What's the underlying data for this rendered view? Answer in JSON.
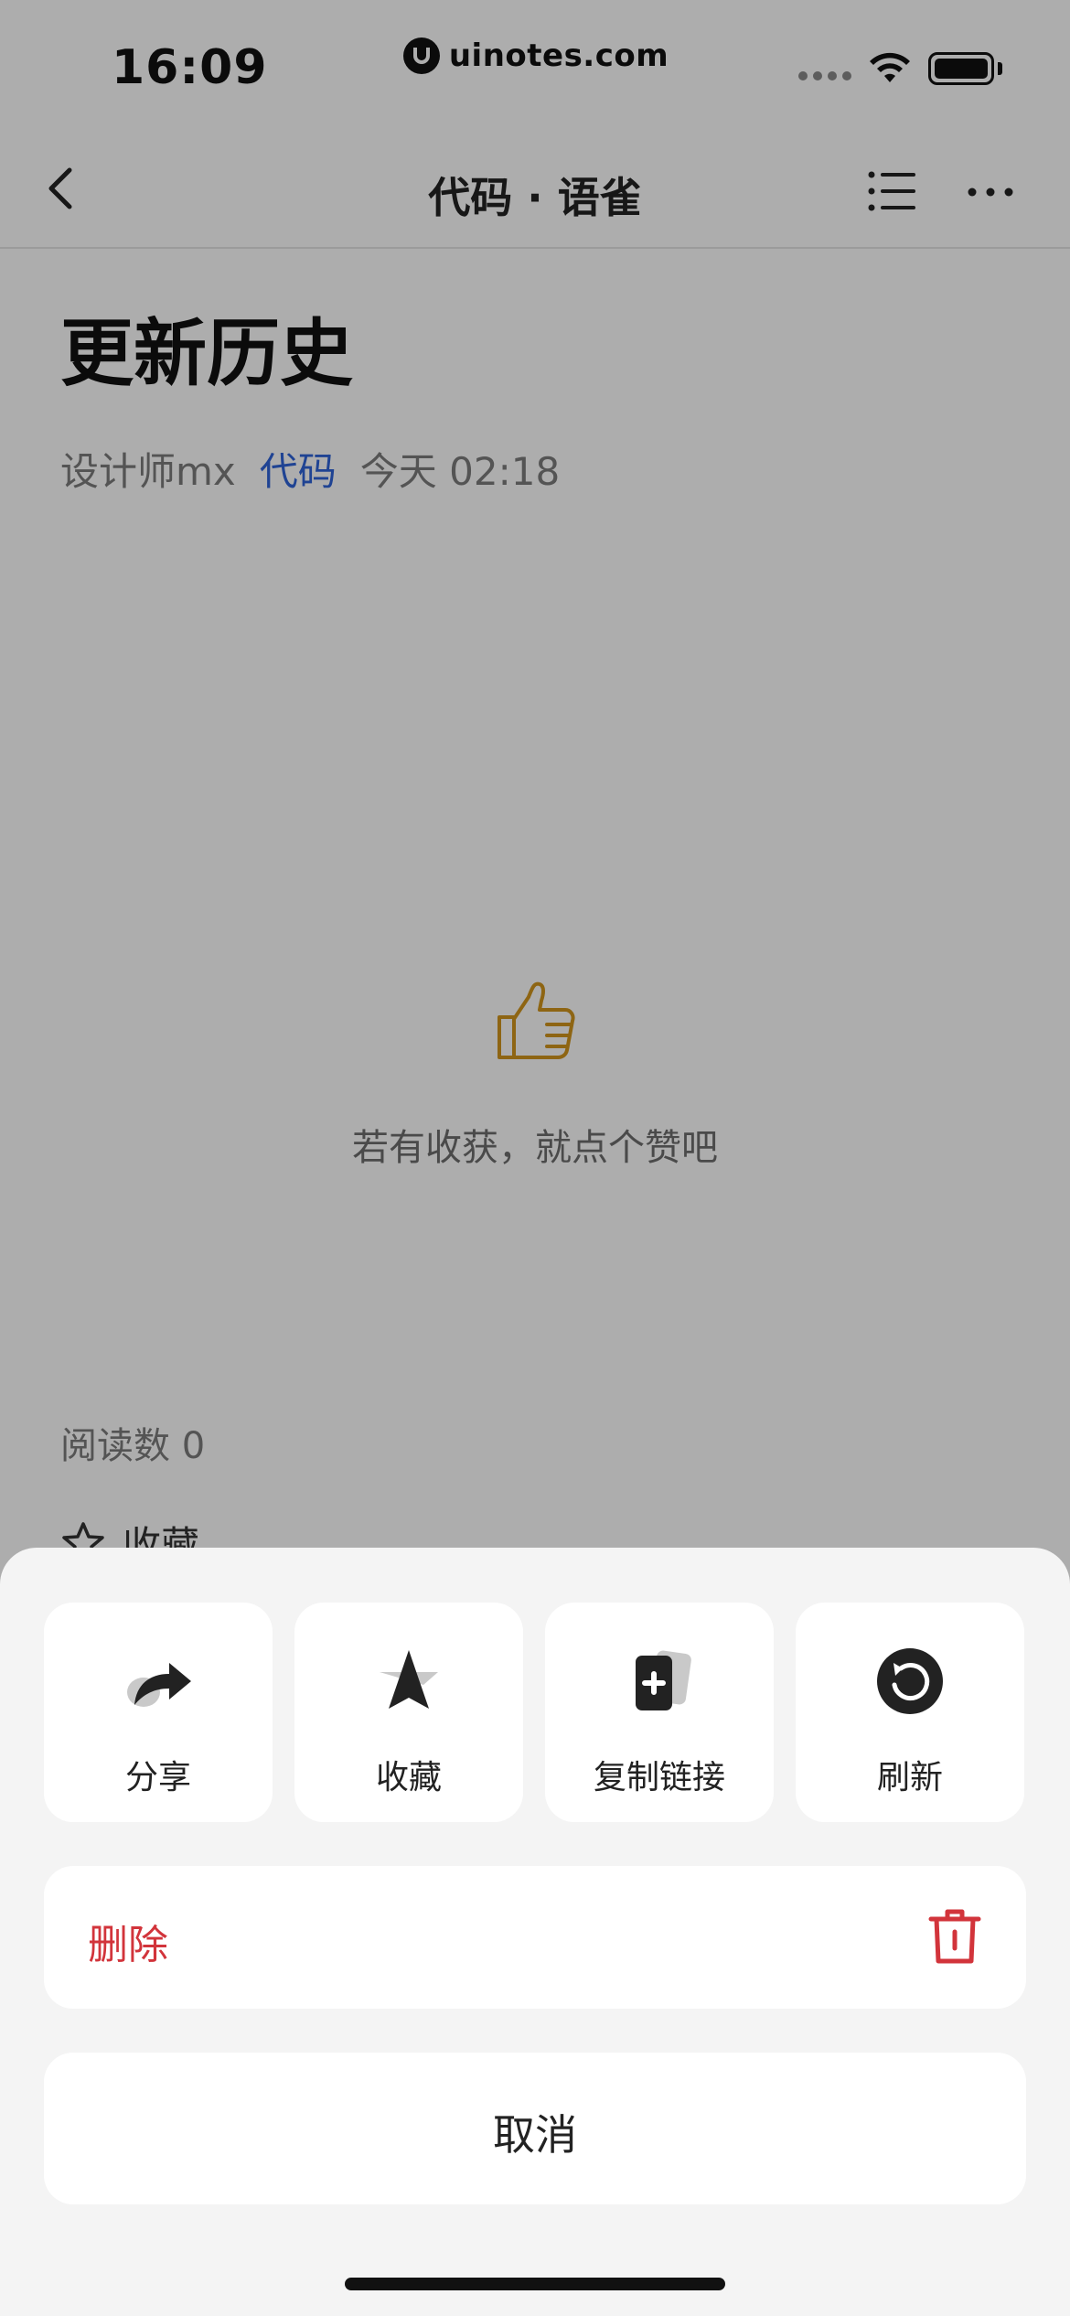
{
  "status_bar": {
    "time": "16:09",
    "url": "uinotes.com"
  },
  "nav": {
    "title": "代码 · 语雀"
  },
  "doc": {
    "title": "更新历史",
    "author": "设计师mx",
    "book": "代码",
    "date": "今天 02:18",
    "like_prompt": "若有收获，就点个赞吧",
    "read_count": "阅读数 0",
    "favorite": "收藏"
  },
  "sheet": {
    "actions": [
      {
        "label": "分享",
        "icon": "share-icon"
      },
      {
        "label": "收藏",
        "icon": "favorite-icon"
      },
      {
        "label": "复制链接",
        "icon": "copy-link-icon"
      },
      {
        "label": "刷新",
        "icon": "refresh-icon"
      }
    ],
    "delete_label": "删除",
    "cancel_label": "取消"
  },
  "colors": {
    "accent_blue": "#2f64d9",
    "danger_red": "#d2343b",
    "like_gold": "#d1961c"
  }
}
